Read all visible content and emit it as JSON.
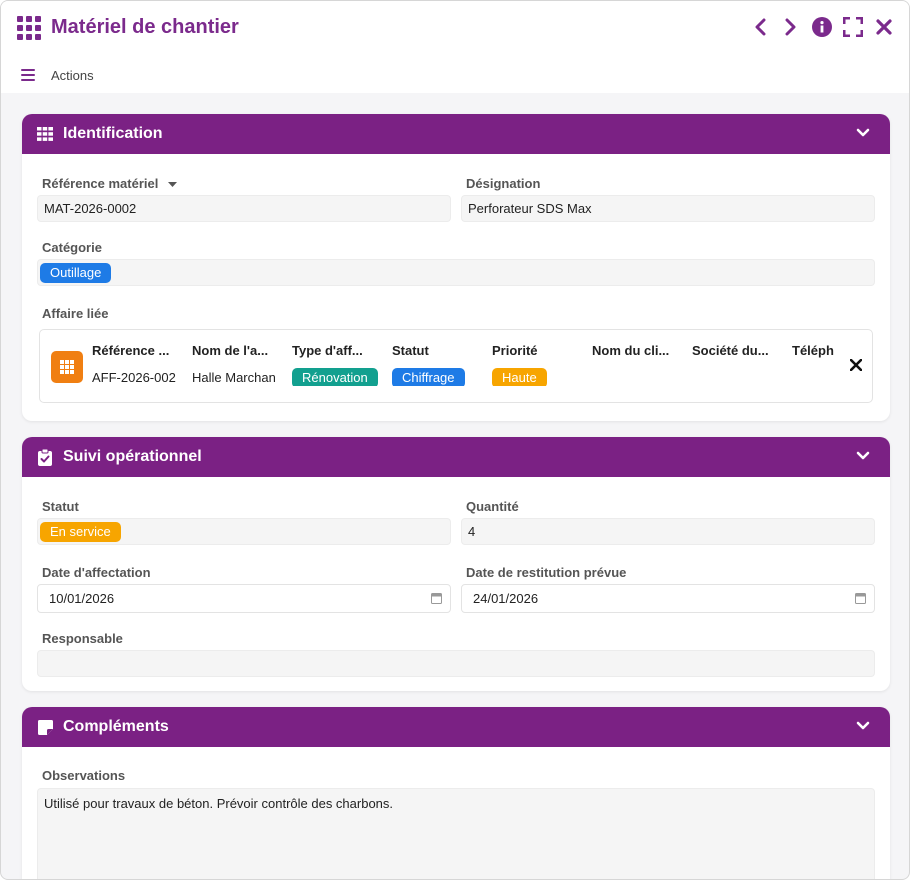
{
  "window": {
    "title": "Matériel de chantier",
    "actions_label": "Actions"
  },
  "colors": {
    "accent": "#7b2184",
    "blue": "#1e7be6",
    "teal": "#12a08f",
    "orange": "#f7a500",
    "icon_orange": "#f07f12"
  },
  "identification": {
    "title": "Identification",
    "reference_label": "Référence matériel",
    "reference_value": "MAT-2026-0002",
    "designation_label": "Désignation",
    "designation_value": "Perforateur SDS Max",
    "categorie_label": "Catégorie",
    "categorie_value": "Outillage",
    "affaire_label": "Affaire liée",
    "affaire": {
      "headers": [
        "Référence ...",
        "Nom de l'a...",
        "Type d'aff...",
        "Statut",
        "Priorité",
        "Nom du cli...",
        "Société du...",
        "Téléph"
      ],
      "reference": "AFF-2026-002",
      "nom": "Halle Marchan",
      "type": "Rénovation",
      "statut": "Chiffrage",
      "priorite": "Haute"
    }
  },
  "suivi": {
    "title": "Suivi opérationnel",
    "statut_label": "Statut",
    "statut_value": "En service",
    "quantite_label": "Quantité",
    "quantite_value": "4",
    "date_affectation_label": "Date d'affectation",
    "date_affectation_value": "10/01/2026",
    "date_restitution_label": "Date de restitution prévue",
    "date_restitution_value": "24/01/2026",
    "responsable_label": "Responsable",
    "responsable_value": ""
  },
  "complements": {
    "title": "Compléments",
    "observations_label": "Observations",
    "observations_value": "Utilisé pour travaux de béton. Prévoir contrôle des charbons."
  }
}
